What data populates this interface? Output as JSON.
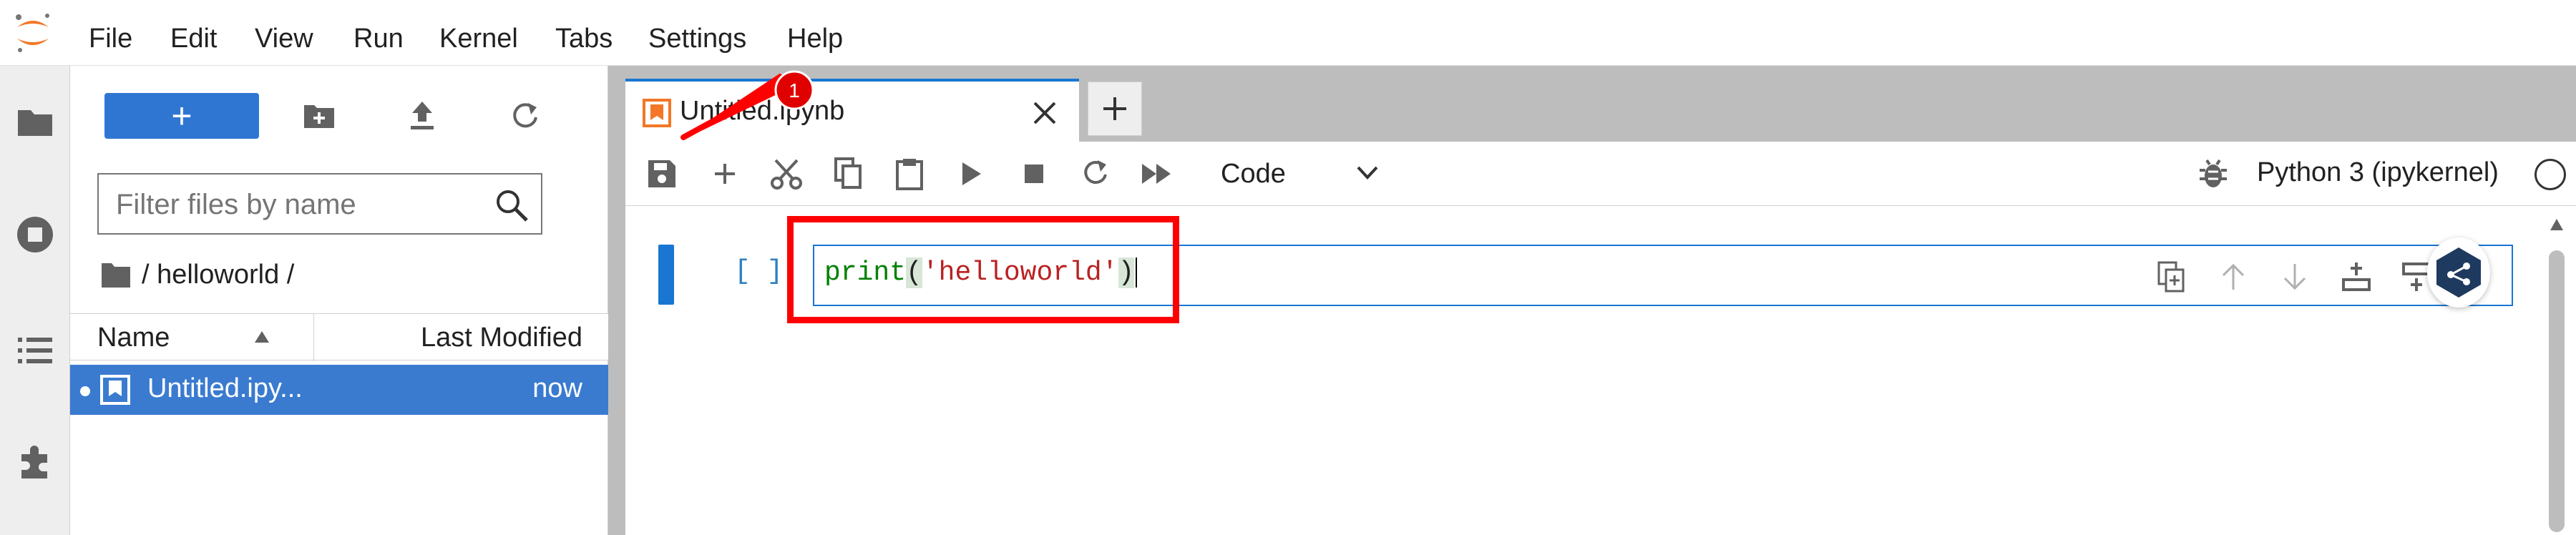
{
  "menubar": {
    "items": [
      "File",
      "Edit",
      "View",
      "Run",
      "Kernel",
      "Tabs",
      "Settings",
      "Help"
    ]
  },
  "activity_bar": {
    "icons": [
      "folder-icon",
      "stop-circle-icon",
      "list-icon",
      "extension-icon"
    ]
  },
  "file_browser": {
    "new_label": "+",
    "filter_placeholder": "Filter files by name",
    "breadcrumb": "/ helloworld /",
    "columns": {
      "name": "Name",
      "modified": "Last Modified"
    },
    "files": [
      {
        "name": "Untitled.ipy...",
        "modified": "now",
        "selected": true
      }
    ]
  },
  "tabs": [
    {
      "label": "Untitled.ipynb"
    }
  ],
  "notebook": {
    "cell_type": "Code",
    "kernel_name": "Python 3 (ipykernel)",
    "cells": [
      {
        "prompt": "[ ]",
        "code": {
          "fn": "print",
          "open": "(",
          "str": "'helloworld'",
          "close": ")"
        }
      }
    ]
  },
  "annotation": {
    "badge": "1"
  },
  "colors": {
    "accent": "#1976d2",
    "selected_row": "#3a7bd0",
    "new_button": "#2f76d2",
    "annotation": "#ff0000"
  }
}
